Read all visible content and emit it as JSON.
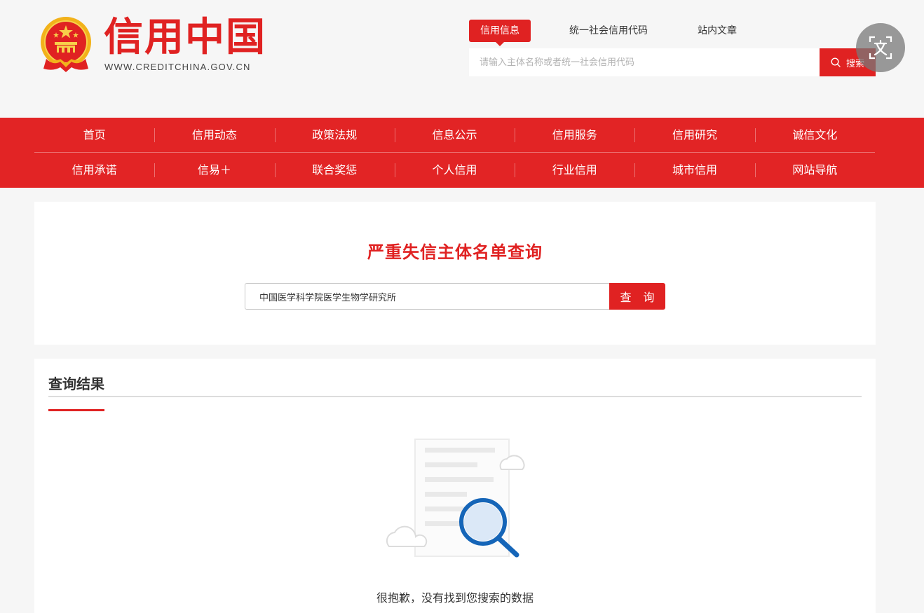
{
  "header": {
    "logo_title": "信用中国",
    "logo_url": "WWW.CREDITCHINA.GOV.CN",
    "search_tabs": [
      {
        "label": "信用信息",
        "active": true
      },
      {
        "label": "统一社会信用代码",
        "active": false
      },
      {
        "label": "站内文章",
        "active": false
      }
    ],
    "search_placeholder": "请输入主体名称或者统一社会信用代码",
    "search_button": "搜索",
    "translate_icon": "translate-icon"
  },
  "nav": {
    "row1": [
      "首页",
      "信用动态",
      "政策法规",
      "信息公示",
      "信用服务",
      "信用研究",
      "诚信文化"
    ],
    "row2": [
      "信用承诺",
      "信易＋",
      "联合奖惩",
      "个人信用",
      "行业信用",
      "城市信用",
      "网站导航"
    ]
  },
  "query": {
    "title": "严重失信主体名单查询",
    "input_value": "中国医学科学院医学生物学研究所",
    "button_label": "查 询"
  },
  "result": {
    "title": "查询结果",
    "empty_message": "很抱歉，没有找到您搜索的数据"
  },
  "colors": {
    "brand_red": "#e02222",
    "nav_red": "#e22425",
    "page_bg": "#f6f6f6"
  }
}
